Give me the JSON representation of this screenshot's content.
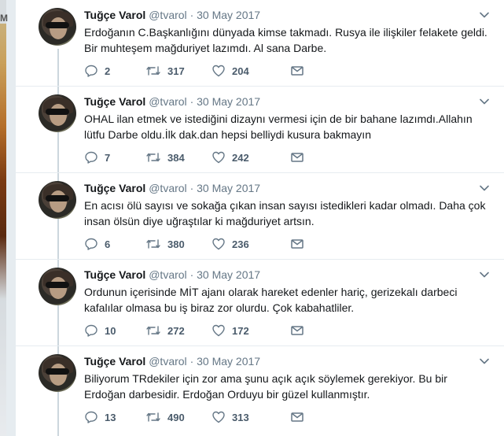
{
  "side_fragment": "M",
  "author": {
    "name": "Tuğçe Varol",
    "handle": "@tvarol"
  },
  "tweets": [
    {
      "date": "30 May 2017",
      "line1": "Erdoğanın C.Başkanlığını dünyada kimse takmadı. Rusya ile ilişkiler felakete geldi.",
      "line2": "Bir muhteşem mağduriyet lazımdı. Al sana Darbe.",
      "replies": "2",
      "retweets": "317",
      "likes": "204"
    },
    {
      "date": "30 May 2017",
      "line1": "OHAL ilan etmek ve istediğini dizaynı vermesi için de bir bahane lazımdı.Allahın",
      "line2": "lütfu Darbe oldu.İlk dak.dan hepsi belliydi kusura bakmayın",
      "replies": "7",
      "retweets": "384",
      "likes": "242"
    },
    {
      "date": "30 May 2017",
      "line1": "En acısı ölü sayısı ve sokağa çıkan insan sayısı istedikleri kadar olmadı. Daha çok",
      "line2": "insan ölsün diye uğraştılar ki mağduriyet artsın.",
      "replies": "6",
      "retweets": "380",
      "likes": "236"
    },
    {
      "date": "30 May 2017",
      "line1": "Ordunun içerisinde MİT ajanı olarak hareket edenler hariç, gerizekalı darbeci",
      "line2": "kafalılar olmasa bu iş biraz zor olurdu. Çok kabahatliler.",
      "replies": "10",
      "retweets": "272",
      "likes": "172"
    },
    {
      "date": "30 May 2017",
      "line1": "Biliyorum TRdekiler için zor ama şunu açık açık söylemek gerekiyor. Bu bir",
      "line2": "Erdoğan darbesidir. Erdoğan Orduyu bir güzel kullanmıştır.",
      "replies": "13",
      "retweets": "490",
      "likes": "313"
    }
  ],
  "icons": {
    "reply": "reply-icon",
    "retweet": "retweet-icon",
    "like": "heart-icon",
    "message": "envelope-icon",
    "menu": "chevron-down-icon"
  },
  "colors": {
    "text": "#14171a",
    "muted": "#657786",
    "thread_line": "#ccd6dd",
    "background": "#e6ecf0"
  }
}
